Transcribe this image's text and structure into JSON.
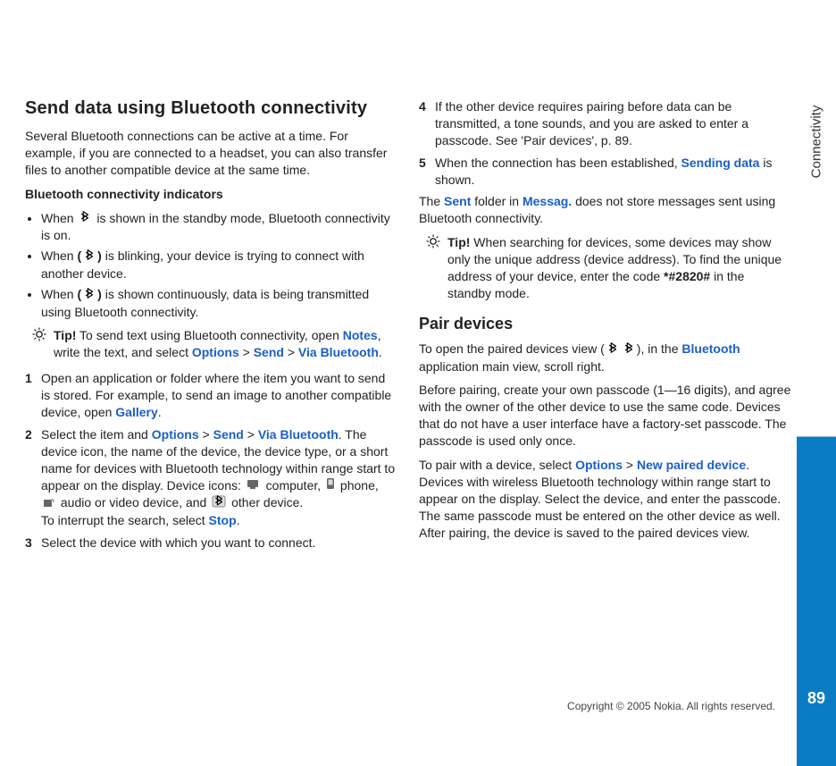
{
  "sidebar": {
    "label": "Connectivity",
    "page_number": "89"
  },
  "left": {
    "h2": "Send data using Bluetooth connectivity",
    "intro": "Several Bluetooth connections can be active at a time. For example, if you are connected to a headset, you can also transfer files to another compatible device at the same time.",
    "indicators_heading": "Bluetooth connectivity indicators",
    "b1a": "When ",
    "b1b": " is shown in the standby mode, Bluetooth connectivity is on.",
    "b2a": "When ",
    "b2b": " is blinking, your device is trying to connect with another device.",
    "b3a": "When ",
    "b3b": " is shown continuously, data is being transmitted using Bluetooth connectivity.",
    "tip1_lead": "Tip!",
    "tip1a": " To send text using Bluetooth connectivity, open ",
    "tip1_notes": "Notes",
    "tip1b": ", write the text, and select ",
    "tip1_options": "Options",
    "tip1_gt1": " > ",
    "tip1_send": "Send",
    "tip1_gt2": " > ",
    "tip1_via": "Via Bluetooth",
    "tip1_end": ".",
    "s1a": "Open an application or folder where the item you want to send is stored. For example, to send an image to another compatible device, open ",
    "s1_gallery": "Gallery",
    "s1b": ".",
    "s2a": "Select the item and ",
    "s2_options": "Options",
    "s2_gt1": " > ",
    "s2_send": "Send",
    "s2_gt2": " > ",
    "s2_via": "Via Bluetooth",
    "s2b": ". The device icon, the name of the device, the device type, or a short name for devices with Bluetooth technology within range start to appear on the display. Device icons: ",
    "s2_comp": " computer, ",
    "s2_phone": " phone, ",
    "s2_audio": " audio or video device, and ",
    "s2_other": " other device.",
    "s2c": "To interrupt the search, select ",
    "s2_stop": "Stop",
    "s2d": ".",
    "s3": "Select the device with which you want to connect."
  },
  "right": {
    "s4": "If the other device requires pairing before data can be transmitted, a tone sounds, and you are asked to enter a passcode. See 'Pair devices', p. 89.",
    "s5a": "When the connection has been established, ",
    "s5_sending": "Sending data",
    "s5b": " is shown.",
    "p_sent_a": "The ",
    "p_sent_sent": "Sent",
    "p_sent_b": " folder in ",
    "p_sent_messag": "Messag.",
    "p_sent_c": " does not store messages sent using Bluetooth connectivity.",
    "tip2_lead": "Tip!",
    "tip2a": " When searching for devices, some devices may show only the unique address (device address). To find the unique address of your device, enter the code ",
    "tip2_code": "*#2820#",
    "tip2b": " in the standby mode.",
    "h3_pair": "Pair devices",
    "pair1a": "To open the paired devices view (",
    "pair1b": "), in the ",
    "pair1_bt": "Bluetooth",
    "pair1c": " application main view, scroll right.",
    "pair2": "Before pairing, create your own passcode (1—16 digits), and agree with the owner of the other device to use the same code. Devices that do not have a user interface have a factory-set passcode. The passcode is used only once.",
    "pair3a": "To pair with a device, select ",
    "pair3_options": "Options",
    "pair3_gt": " > ",
    "pair3_new": "New paired device",
    "pair3b": ". Devices with wireless Bluetooth technology within range start to appear on the display. Select the device, and enter the passcode. The same passcode must be entered on the other device as well. After pairing, the device is saved to the paired devices view."
  },
  "copyright": "Copyright © 2005 Nokia. All rights reserved."
}
